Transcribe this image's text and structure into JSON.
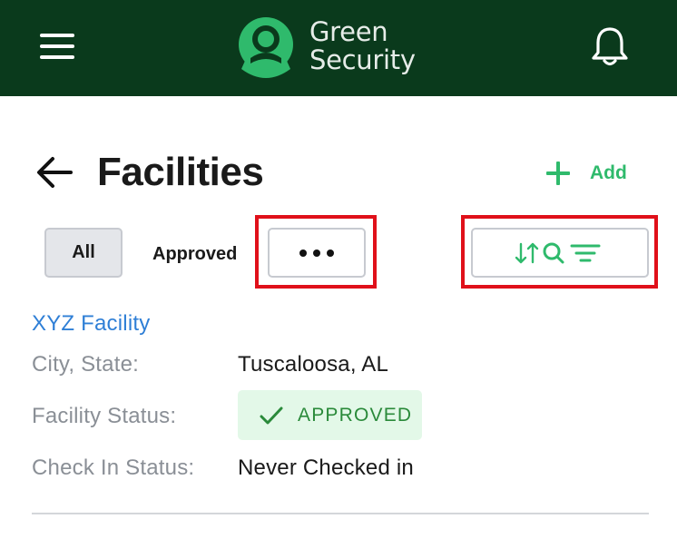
{
  "header": {
    "logo_line1": "Green",
    "logo_line2": "Security"
  },
  "page": {
    "title": "Facilities",
    "add_label": "Add"
  },
  "filters": {
    "tabs": [
      {
        "label": "All",
        "selected": true
      },
      {
        "label": "Approved",
        "selected": false
      }
    ],
    "more_icon": "more-horizontal-icon",
    "tools_icons": [
      "sort-icon",
      "search-icon",
      "filter-icon"
    ]
  },
  "facility": {
    "name": "XYZ Facility",
    "city_state_label": "City, State:",
    "city_state_value": "Tuscaloosa, AL",
    "status_label": "Facility Status:",
    "status_value": "APPROVED",
    "checkin_label": "Check In Status:",
    "checkin_value": "Never Checked in"
  },
  "colors": {
    "header_bg": "#0a3a1c",
    "brand_green": "#2fba6c",
    "link_blue": "#2f7fd6",
    "highlight_red": "#e0101a",
    "badge_bg": "#e3f8e8",
    "badge_text": "#2a8a3a"
  }
}
